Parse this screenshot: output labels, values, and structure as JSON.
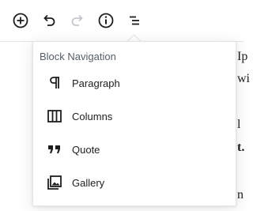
{
  "toolbar": {
    "buttons": [
      {
        "name": "add-block-button",
        "icon": "plus-circle-icon",
        "enabled": true
      },
      {
        "name": "undo-button",
        "icon": "undo-icon",
        "enabled": true
      },
      {
        "name": "redo-button",
        "icon": "redo-icon",
        "enabled": false
      },
      {
        "name": "content-info-button",
        "icon": "info-icon",
        "enabled": true
      },
      {
        "name": "block-navigation-button",
        "icon": "list-icon",
        "enabled": true
      }
    ]
  },
  "block_navigation": {
    "title": "Block Navigation",
    "items": [
      {
        "label": "Paragraph",
        "icon": "paragraph-icon"
      },
      {
        "label": "Columns",
        "icon": "columns-icon"
      },
      {
        "label": "Quote",
        "icon": "quote-icon"
      },
      {
        "label": "Gallery",
        "icon": "gallery-icon"
      }
    ]
  },
  "background_text": [
    "Ip",
    "wi",
    "l",
    "t.",
    "n"
  ],
  "colors": {
    "icon": "#1e1e1e",
    "icon_disabled": "#c4c7cc",
    "border": "#e2e4e7",
    "title_text": "#555d66"
  }
}
